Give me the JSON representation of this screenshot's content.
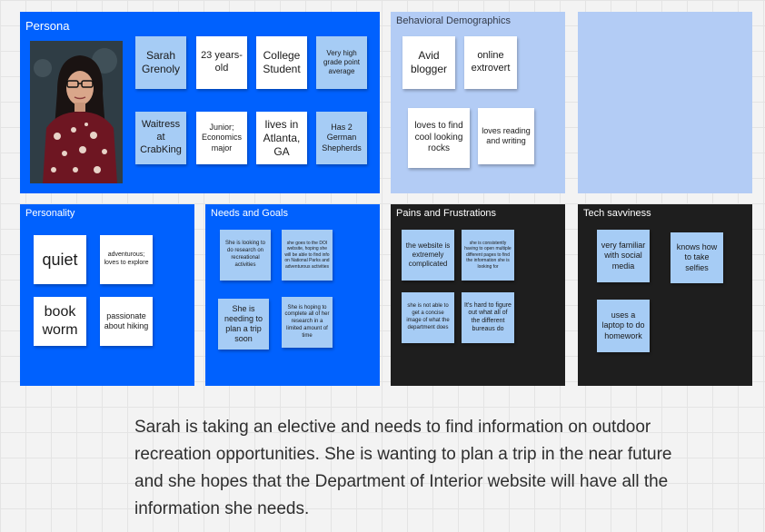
{
  "colors": {
    "frame_blue": "#0061fe",
    "frame_lightblue": "#b3ccf5",
    "frame_dark": "#1e1e1e",
    "sticky_lightblue": "#a6ccf5",
    "sticky_white": "#ffffff",
    "canvas": "#f3f3f3"
  },
  "persona": {
    "title": "Persona",
    "notes": [
      "Sarah Grenoly",
      "23 years-old",
      "College Student",
      "Very high grade point average",
      "Waitress at CrabKing",
      "Junior; Economics major",
      "lives in Atlanta, GA",
      "Has 2 German Shepherds"
    ]
  },
  "behavioral": {
    "title": "Behavioral Demographics",
    "notes": [
      "Avid blogger",
      "online extrovert",
      "loves to find cool looking rocks",
      "loves reading and writing"
    ]
  },
  "personality": {
    "title": "Personality",
    "notes": [
      "quiet",
      "adventurous; loves to explore",
      "book worm",
      "passionate about hiking"
    ]
  },
  "needs": {
    "title": "Needs and Goals",
    "notes": [
      "She is looking to do research on recreational activities",
      "she goes to the DOI website, hoping she will be able to find info on National Parks and adventurous activities",
      "She is needing to plan a trip soon",
      "She is hoping to complete all of her research in a limited amount of time"
    ]
  },
  "pains": {
    "title": "Pains and Frustrations",
    "notes": [
      "the website is extremely complicated",
      "she is consistently having to open multiple different pages to find the information she is looking for",
      "she is not able to get a concise image of what the department does",
      "It's hard to figure out what all of the different bureaus do"
    ]
  },
  "tech": {
    "title": "Tech savviness",
    "notes": [
      "very familiar with social media",
      "knows how to take selfies",
      "uses a laptop to do homework"
    ]
  },
  "caption": "Sarah is taking an elective and needs to find information on outdoor recreation opportunities. She is wanting to plan a trip in the near future and she hopes that the Department of Interior website will have all the information she needs."
}
